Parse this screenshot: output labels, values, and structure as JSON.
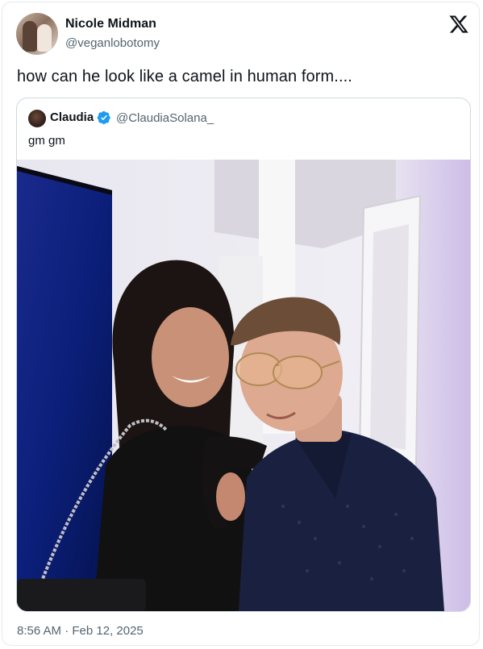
{
  "tweet": {
    "author_name": "Nicole Midman",
    "author_handle": "@veganlobotomy",
    "text": "how can he look like a camel in human form....",
    "timestamp": "8:56 AM · Feb 12, 2025",
    "brand_icon": "x-logo-icon"
  },
  "quoted_tweet": {
    "author_name": "Claudia",
    "author_handle": "@ClaudiaSolana_",
    "text": "gm gm",
    "verified_icon": "verified-badge-icon",
    "verified_color": "#1d9bf0"
  },
  "colors": {
    "text_primary": "#0f1419",
    "text_secondary": "#536471",
    "border": "#cfd9de"
  }
}
